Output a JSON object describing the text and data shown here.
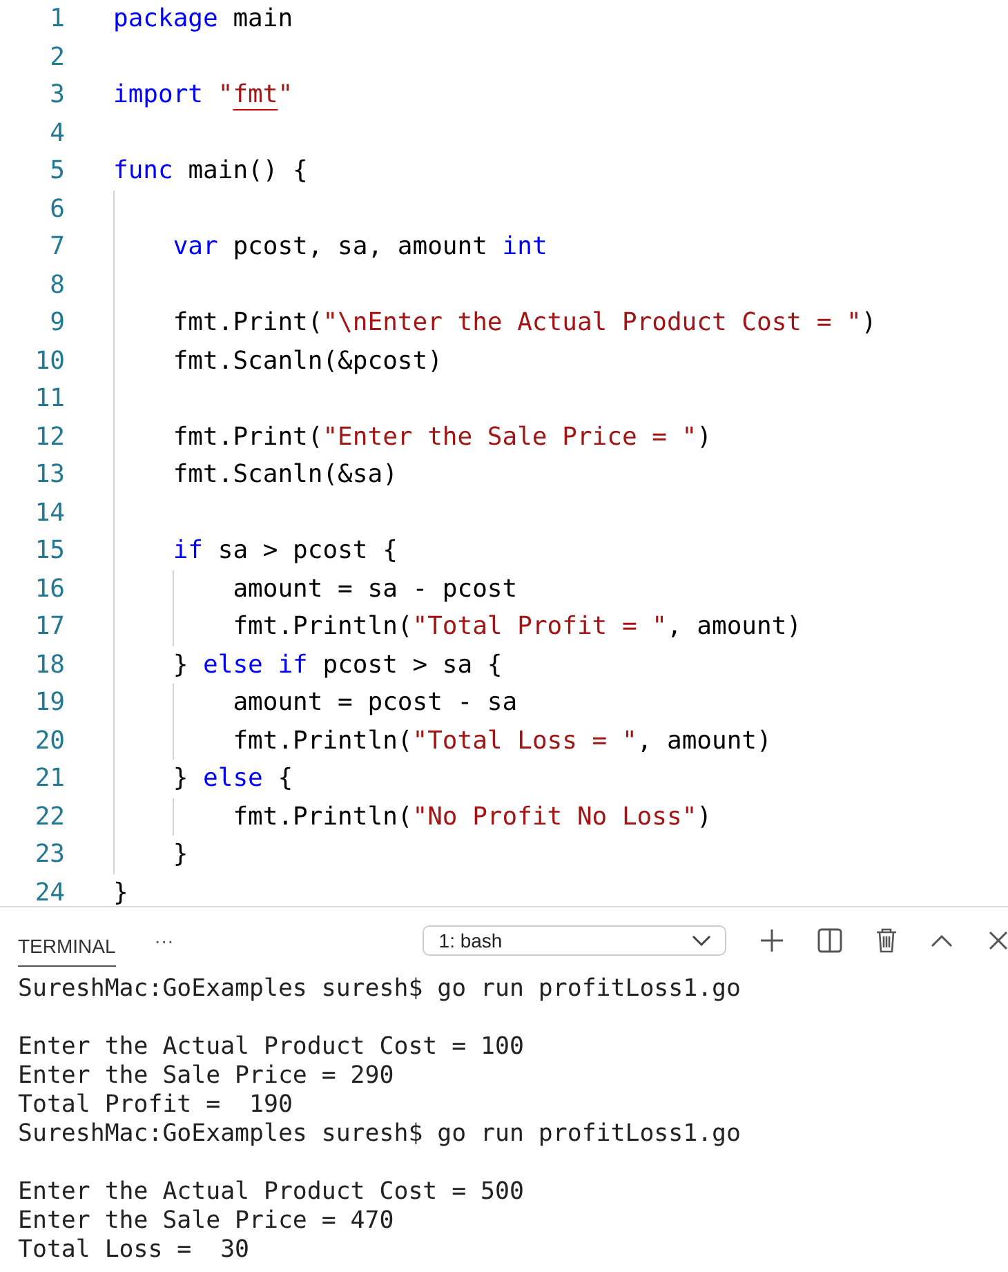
{
  "editor": {
    "lines": [
      {
        "number": "1",
        "tokens": [
          {
            "kind": "keyword",
            "text": "package"
          },
          {
            "kind": "plain",
            "text": " main"
          }
        ]
      },
      {
        "number": "2"
      },
      {
        "number": "3",
        "tokens": [
          {
            "kind": "keyword",
            "text": "import "
          },
          {
            "kind": "string",
            "text": "\""
          },
          {
            "kind": "error-string",
            "text": "fmt"
          },
          {
            "kind": "string",
            "text": "\""
          }
        ]
      },
      {
        "number": "4"
      },
      {
        "number": "5",
        "tokens": [
          {
            "kind": "keyword",
            "text": "func"
          },
          {
            "kind": "plain",
            "text": " main() {"
          }
        ]
      },
      {
        "number": "6"
      },
      {
        "number": "7",
        "tokens": [
          {
            "kind": "keyword",
            "text": "    var"
          },
          {
            "kind": "plain",
            "text": " pcost, sa, amount "
          },
          {
            "kind": "keyword",
            "text": "int"
          }
        ]
      },
      {
        "number": "8"
      },
      {
        "number": "9",
        "tokens": [
          {
            "kind": "plain",
            "text": "    fmt.Print("
          },
          {
            "kind": "string",
            "text": "\"\\nEnter the Actual Product Cost = \""
          },
          {
            "kind": "plain",
            "text": ")"
          }
        ]
      },
      {
        "number": "10",
        "tokens": [
          {
            "kind": "plain",
            "text": "    fmt.Scanln(&pcost)"
          }
        ]
      },
      {
        "number": "11"
      },
      {
        "number": "12",
        "tokens": [
          {
            "kind": "plain",
            "text": "    fmt.Print("
          },
          {
            "kind": "string",
            "text": "\"Enter the Sale Price = \""
          },
          {
            "kind": "plain",
            "text": ")"
          }
        ]
      },
      {
        "number": "13",
        "tokens": [
          {
            "kind": "plain",
            "text": "    fmt.Scanln(&sa)"
          }
        ]
      },
      {
        "number": "14"
      },
      {
        "number": "15",
        "tokens": [
          {
            "kind": "keyword",
            "text": "    if"
          },
          {
            "kind": "plain",
            "text": " sa > pcost {"
          }
        ]
      },
      {
        "number": "16",
        "tokens": [
          {
            "kind": "plain",
            "text": "        amount = sa - pcost"
          }
        ]
      },
      {
        "number": "17",
        "tokens": [
          {
            "kind": "plain",
            "text": "        fmt.Println("
          },
          {
            "kind": "string",
            "text": "\"Total Profit = \""
          },
          {
            "kind": "plain",
            "text": ", amount)"
          }
        ]
      },
      {
        "number": "18",
        "tokens": [
          {
            "kind": "plain",
            "text": "    } "
          },
          {
            "kind": "keyword",
            "text": "else if"
          },
          {
            "kind": "plain",
            "text": " pcost > sa {"
          }
        ]
      },
      {
        "number": "19",
        "tokens": [
          {
            "kind": "plain",
            "text": "        amount = pcost - sa"
          }
        ]
      },
      {
        "number": "20",
        "tokens": [
          {
            "kind": "plain",
            "text": "        fmt.Println("
          },
          {
            "kind": "string",
            "text": "\"Total Loss = \""
          },
          {
            "kind": "plain",
            "text": ", amount)"
          }
        ]
      },
      {
        "number": "21",
        "tokens": [
          {
            "kind": "plain",
            "text": "    } "
          },
          {
            "kind": "keyword",
            "text": "else"
          },
          {
            "kind": "plain",
            "text": " {"
          }
        ]
      },
      {
        "number": "22",
        "tokens": [
          {
            "kind": "plain",
            "text": "        fmt.Println("
          },
          {
            "kind": "string",
            "text": "\"No Profit No Loss\""
          },
          {
            "kind": "plain",
            "text": ")"
          }
        ]
      },
      {
        "number": "23",
        "tokens": [
          {
            "kind": "plain",
            "text": "    }"
          }
        ]
      },
      {
        "number": "24",
        "tokens": [
          {
            "kind": "plain",
            "text": "}"
          }
        ]
      }
    ]
  },
  "panel": {
    "tabs": [
      {
        "label": "TERMINAL",
        "selected": true
      }
    ],
    "more": "···",
    "terminal_select": "1: bash",
    "terminal_runs": [
      {
        "command": "SureshMac:GoExamples suresh$ go run profitLoss1.go",
        "output": [
          "Enter the Actual Product Cost = 100",
          "Enter the Sale Price = 290",
          "Total Profit =  190"
        ]
      },
      {
        "command": "SureshMac:GoExamples suresh$ go run profitLoss1.go",
        "output": [
          "Enter the Actual Product Cost = 500",
          "Enter the Sale Price = 470",
          "Total Loss =  30"
        ]
      }
    ]
  }
}
